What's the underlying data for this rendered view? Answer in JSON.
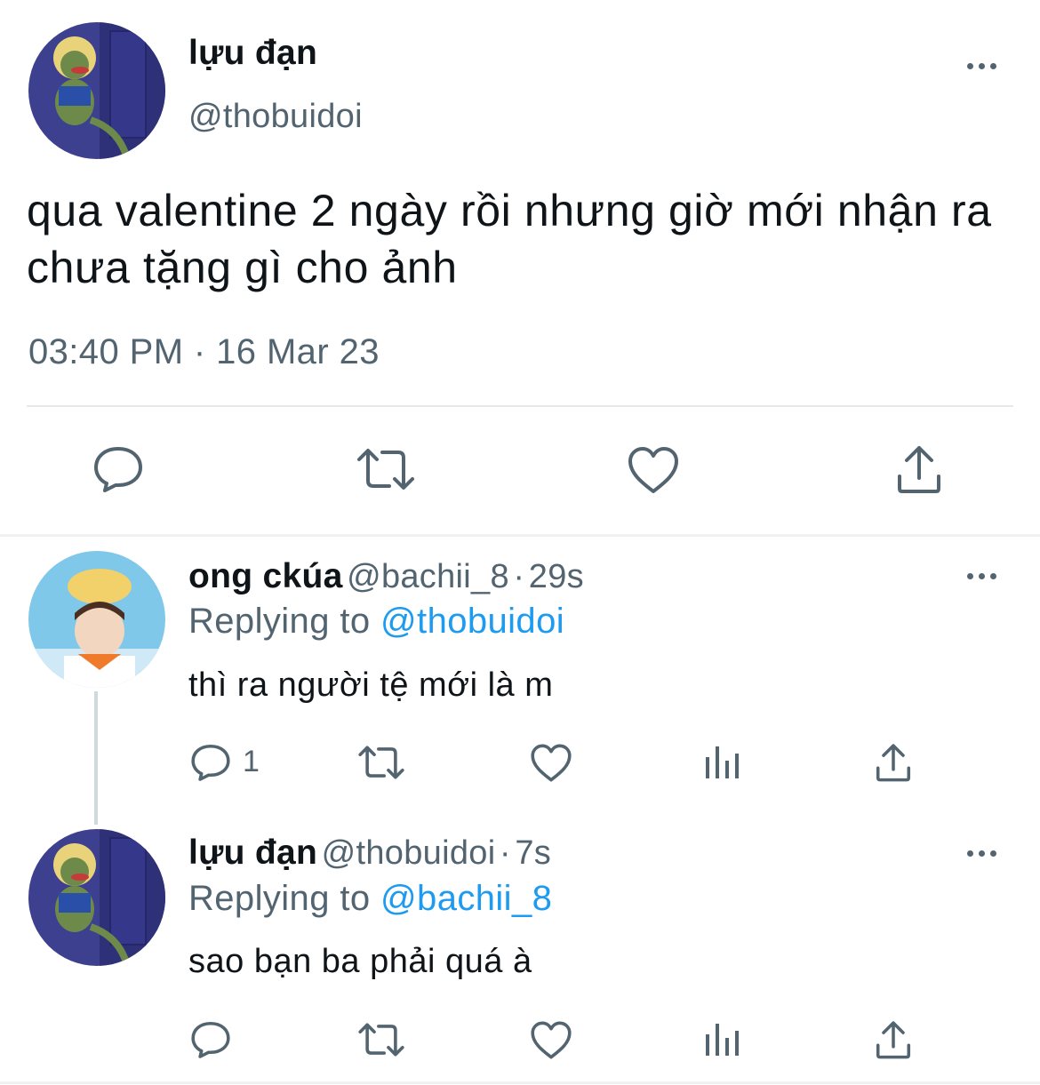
{
  "main_tweet": {
    "display_name": "lựu đạn",
    "handle": "@thobuidoi",
    "text": "qua valentine 2 ngày rồi nhưng giờ mới nhận ra chưa tặng gì cho ảnh",
    "timestamp": "03:40 PM · 16 Mar 23",
    "actions": [
      "reply-icon",
      "retweet-icon",
      "like-icon",
      "share-icon"
    ]
  },
  "replies": [
    {
      "display_name": "ong ckúa",
      "handle": "@bachii_8",
      "separator": "·",
      "time": "29s",
      "replying_prefix": "Replying to",
      "replying_to": "@thobuidoi",
      "text": "thì ra người tệ mới là m",
      "reply_count": "1",
      "actions": [
        "reply-icon",
        "retweet-icon",
        "like-icon",
        "views-icon",
        "share-icon"
      ]
    },
    {
      "display_name": "lựu đạn",
      "handle": "@thobuidoi",
      "separator": "·",
      "time": "7s",
      "replying_prefix": "Replying to",
      "replying_to": "@bachii_8",
      "text": "sao bạn ba phải quá à",
      "actions": [
        "reply-icon",
        "retweet-icon",
        "like-icon",
        "views-icon",
        "share-icon"
      ]
    }
  ],
  "colors": {
    "text_primary": "#0f1419",
    "text_secondary": "#536471",
    "mention": "#1d9bf0",
    "divider": "#e6e9eb",
    "thread_line": "#cfd9de"
  }
}
